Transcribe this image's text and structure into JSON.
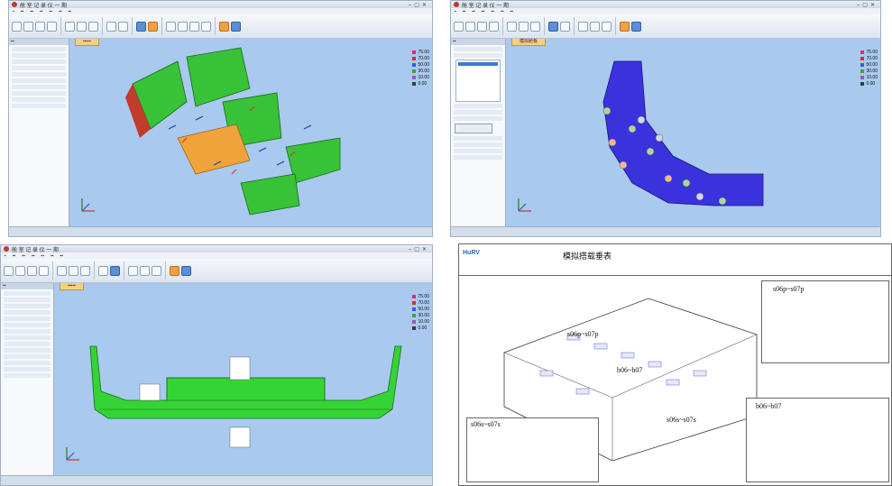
{
  "windows": [
    {
      "id": "tl",
      "title": "舱 室 记 录 仪 一 期"
    },
    {
      "id": "tr",
      "title": "舱 室 记 录 仪 一 期",
      "tab": "模拟舱板"
    },
    {
      "id": "bl",
      "title": "舱 室 记 录 仪 一 期"
    }
  ],
  "legend_values": [
    "75.00",
    "70.00",
    "50.00",
    "30.00",
    "10.00",
    "0.00"
  ],
  "legend_colors": [
    "#d1307a",
    "#c23b2b",
    "#3a5bd8",
    "#4a9e3a",
    "#9b59b6",
    "#3b3b3b"
  ],
  "doc": {
    "brand": "HuRV",
    "title": "模拟搭载垂表",
    "labels": [
      "s06p~s07p",
      "s06p~s07p",
      "b06~b07",
      "b06~b07",
      "s06s~s07s",
      "s06s~s07s"
    ]
  }
}
